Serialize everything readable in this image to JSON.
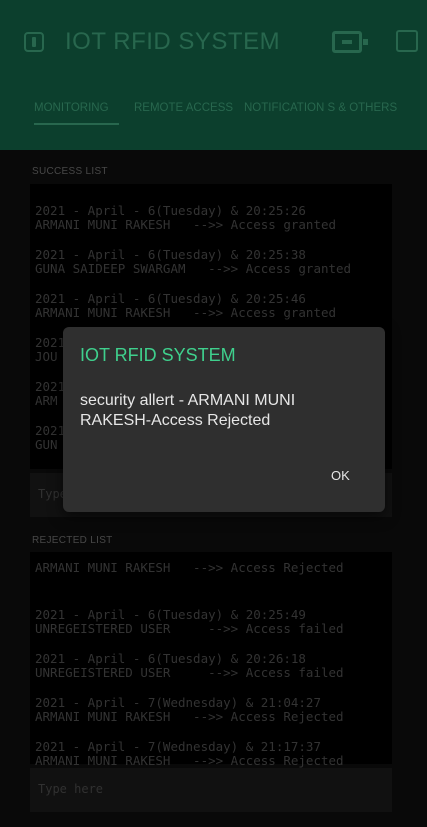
{
  "app": {
    "title": "IOT RFID SYSTEM"
  },
  "header_icons": [
    "menu-icon",
    "battery-icon",
    "square-icon"
  ],
  "tabs": [
    {
      "label": "MONITORING",
      "active": true
    },
    {
      "label": "REMOTE ACCESS",
      "active": false
    },
    {
      "label": "NOTIFICATION S & OTHERS",
      "active": false
    }
  ],
  "success": {
    "label": "SUCCESS LIST",
    "entries": [
      {
        "line1": "2021 - April - 6(Tuesday) & 20:25:26",
        "line2": "ARMANI MUNI RAKESH   -->> Access granted"
      },
      {
        "line1": "2021 - April - 6(Tuesday) & 20:25:38",
        "line2": "GUNA SAIDEEP SWARGAM   -->> Access granted"
      },
      {
        "line1": "2021 - April - 6(Tuesday) & 20:25:46",
        "line2": "ARMANI MUNI RAKESH   -->> Access granted"
      },
      {
        "line1": "2021",
        "line2": "JOU"
      },
      {
        "line1": "2021",
        "line2": "ARM"
      },
      {
        "line1": "2021",
        "line2": "GUN"
      }
    ],
    "placeholder": "Type here"
  },
  "rejected": {
    "label": "REJECTED LIST",
    "first_line": "ARMANI MUNI RAKESH   -->> Access Rejected",
    "entries": [
      {
        "line1": "2021 - April - 6(Tuesday) & 20:25:49",
        "line2": "UNREGEISTERED USER     -->> Access failed"
      },
      {
        "line1": "2021 - April - 6(Tuesday) & 20:26:18",
        "line2": "UNREGEISTERED USER     -->> Access failed"
      },
      {
        "line1": "2021 - April - 7(Wednesday) & 21:04:27",
        "line2": "ARMANI MUNI RAKESH   -->> Access Rejected"
      },
      {
        "line1": "2021 - April - 7(Wednesday) & 21:17:37",
        "line2": "ARMANI MUNI RAKESH   -->> Access Rejected"
      }
    ],
    "placeholder": "Type here"
  },
  "dialog": {
    "title": "IOT RFID SYSTEM",
    "message": "security allert - ARMANI MUNI RAKESH-Access Rejected",
    "ok_label": "OK"
  },
  "colors": {
    "header_bg": "#0f4a35",
    "accent": "#2f7a5c",
    "dialog_title": "#3fd08d"
  }
}
